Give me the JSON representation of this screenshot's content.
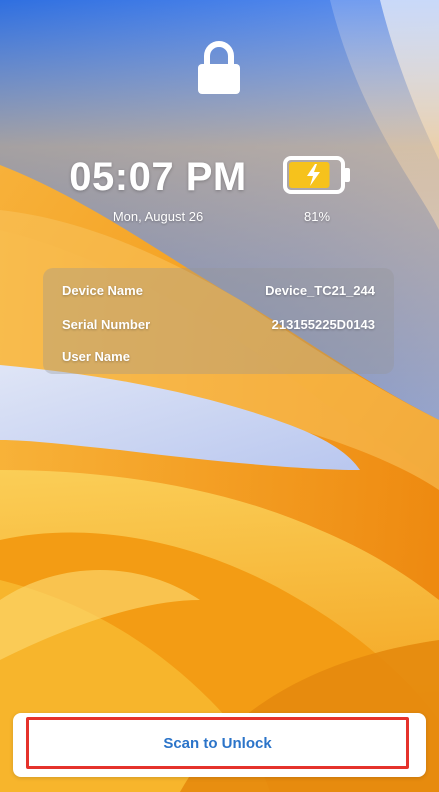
{
  "lock_screen": {
    "time": "05:07 PM",
    "date": "Mon, August 26",
    "battery": {
      "percent_label": "81%",
      "level": 0.81,
      "charging": true
    }
  },
  "device_info": [
    {
      "label": "Device Name",
      "value": "Device_TC21_244"
    },
    {
      "label": "Serial Number",
      "value": "213155225D0143"
    },
    {
      "label": "User Name",
      "value": ""
    }
  ],
  "actions": {
    "unlock_label": "Scan to Unlock"
  },
  "icons": {
    "lock": "lock-icon",
    "battery": "battery-charging-icon"
  },
  "colors": {
    "accent_text": "#2b74c9",
    "highlight_border": "#e5322b",
    "battery_fill": "#f6c21c",
    "wallpaper_sky": "#3f7fe6",
    "wallpaper_orange": "#f59a1c"
  }
}
